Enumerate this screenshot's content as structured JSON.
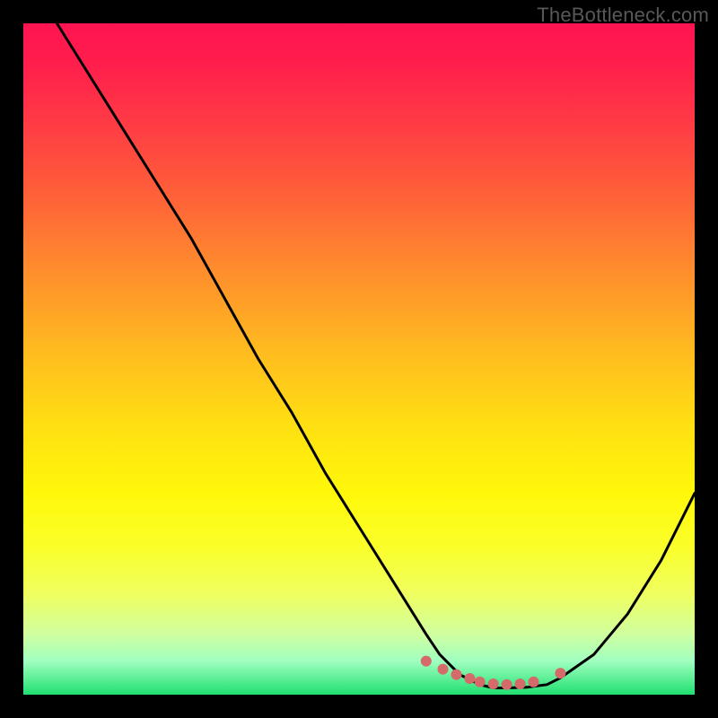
{
  "watermark": "TheBottleneck.com",
  "chart_data": {
    "type": "line",
    "title": "",
    "xlabel": "",
    "ylabel": "",
    "xlim": [
      0,
      100
    ],
    "ylim": [
      0,
      100
    ],
    "grid": false,
    "legend": false,
    "series": [
      {
        "name": "curve",
        "x": [
          5,
          10,
          15,
          20,
          25,
          30,
          35,
          40,
          45,
          50,
          55,
          60,
          62,
          65,
          68,
          70,
          72,
          75,
          78,
          80,
          85,
          90,
          95,
          100
        ],
        "y": [
          100,
          92,
          84,
          76,
          68,
          59,
          50,
          42,
          33,
          25,
          17,
          9,
          6,
          3,
          1.5,
          1,
          1,
          1.1,
          1.5,
          2.5,
          6,
          12,
          20,
          30
        ]
      }
    ],
    "markers": {
      "name": "near-optimum-dots",
      "x": [
        60,
        62.5,
        64.5,
        66.5,
        68,
        70,
        72,
        74,
        76,
        80
      ],
      "y": [
        5,
        3.8,
        3,
        2.4,
        1.9,
        1.6,
        1.5,
        1.6,
        1.9,
        3.2
      ]
    },
    "colors": {
      "curve": "#000000",
      "markers": "#d46a6a",
      "gradient_top": "#ff1452",
      "gradient_bottom": "#20e070"
    }
  }
}
